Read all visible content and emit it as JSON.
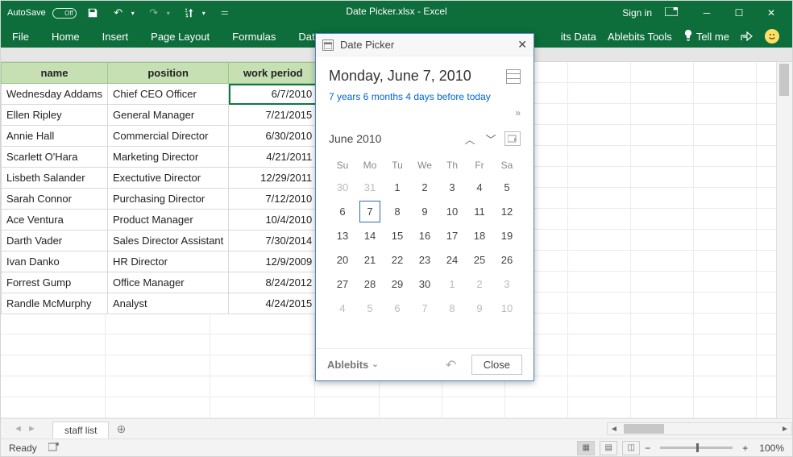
{
  "titlebar": {
    "autosave_label": "AutoSave",
    "autosave_state": "Off",
    "doc_title": "Date Picker.xlsx  -  Excel",
    "signin": "Sign in"
  },
  "ribbon": {
    "tabs": [
      "File",
      "Home",
      "Insert",
      "Page Layout",
      "Formulas",
      "Data"
    ],
    "right": {
      "ablebits_data": "its Data",
      "ablebits_tools": "Ablebits Tools",
      "tell_me": "Tell me"
    }
  },
  "sheet": {
    "headers": [
      "name",
      "position",
      "work period"
    ],
    "rows": [
      {
        "name": "Wednesday Addams",
        "position": "Chief CEO Officer",
        "wp": "6/7/2010",
        "selected": true
      },
      {
        "name": "Ellen Ripley",
        "position": "General Manager",
        "wp": "7/21/2015"
      },
      {
        "name": "Annie Hall",
        "position": "Commercial Director",
        "wp": "6/30/2010"
      },
      {
        "name": "Scarlett O'Hara",
        "position": "Marketing Director",
        "wp": "4/21/2011"
      },
      {
        "name": "Lisbeth Salander",
        "position": "Exectutive Director",
        "wp": "12/29/2011"
      },
      {
        "name": "Sarah Connor",
        "position": "Purchasing Director",
        "wp": "7/12/2010"
      },
      {
        "name": "Ace Ventura",
        "position": "Product Manager",
        "wp": "10/4/2010"
      },
      {
        "name": "Darth Vader",
        "position": "Sales Director Assistant",
        "wp": "7/30/2014"
      },
      {
        "name": "Ivan Danko",
        "position": "HR Director",
        "wp": "12/9/2009"
      },
      {
        "name": "Forrest Gump",
        "position": "Office Manager",
        "wp": "8/24/2012"
      },
      {
        "name": "Randle McMurphy",
        "position": "Analyst",
        "wp": "4/24/2015"
      }
    ],
    "tab_name": "staff list"
  },
  "pane": {
    "title": "Date Picker",
    "heading": "Monday, June 7, 2010",
    "sub": "7 years 6 months 4 days before today",
    "month": "June 2010",
    "dow": [
      "Su",
      "Mo",
      "Tu",
      "We",
      "Th",
      "Fr",
      "Sa"
    ],
    "weeks": [
      [
        {
          "d": "30",
          "dim": true
        },
        {
          "d": "31",
          "dim": true
        },
        {
          "d": "1"
        },
        {
          "d": "2"
        },
        {
          "d": "3"
        },
        {
          "d": "4"
        },
        {
          "d": "5"
        }
      ],
      [
        {
          "d": "6"
        },
        {
          "d": "7",
          "sel": true
        },
        {
          "d": "8"
        },
        {
          "d": "9"
        },
        {
          "d": "10"
        },
        {
          "d": "11"
        },
        {
          "d": "12"
        }
      ],
      [
        {
          "d": "13"
        },
        {
          "d": "14"
        },
        {
          "d": "15"
        },
        {
          "d": "16"
        },
        {
          "d": "17"
        },
        {
          "d": "18"
        },
        {
          "d": "19"
        }
      ],
      [
        {
          "d": "20"
        },
        {
          "d": "21"
        },
        {
          "d": "22"
        },
        {
          "d": "23"
        },
        {
          "d": "24"
        },
        {
          "d": "25"
        },
        {
          "d": "26"
        }
      ],
      [
        {
          "d": "27"
        },
        {
          "d": "28"
        },
        {
          "d": "29"
        },
        {
          "d": "30"
        },
        {
          "d": "1",
          "dim": true
        },
        {
          "d": "2",
          "dim": true
        },
        {
          "d": "3",
          "dim": true
        }
      ],
      [
        {
          "d": "4",
          "dim": true
        },
        {
          "d": "5",
          "dim": true
        },
        {
          "d": "6",
          "dim": true
        },
        {
          "d": "7",
          "dim": true
        },
        {
          "d": "8",
          "dim": true
        },
        {
          "d": "9",
          "dim": true
        },
        {
          "d": "10",
          "dim": true
        }
      ]
    ],
    "brand": "Ablebits",
    "close_label": "Close"
  },
  "statusbar": {
    "ready": "Ready",
    "zoom": "100%",
    "minus": "−",
    "plus": "+"
  }
}
